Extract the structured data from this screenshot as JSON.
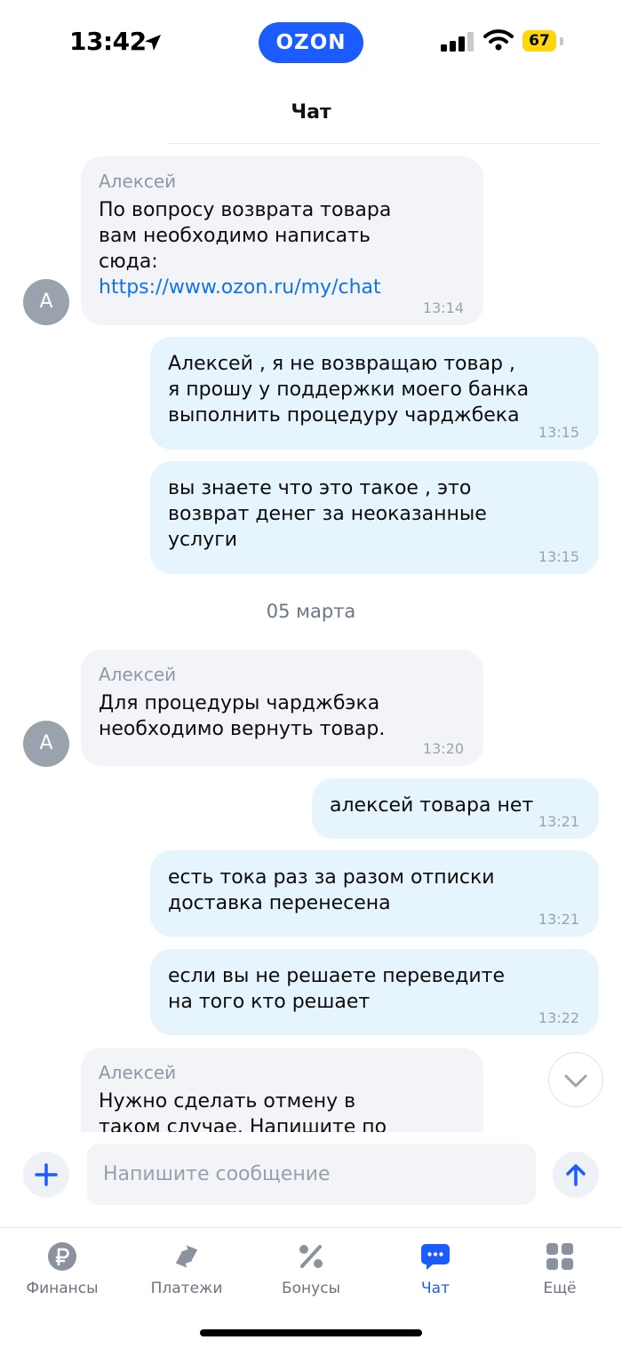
{
  "status_bar": {
    "time": "13:42",
    "brand": "OZON",
    "battery": "67"
  },
  "header": {
    "title": "Чат"
  },
  "messages": [
    {
      "sender": "Алексей",
      "text": "По вопросу возврата товара\nвам необходимо написать\nсюда:",
      "link": "https://www.ozon.ru/my/chat",
      "time": "13:14",
      "avatar": "А"
    },
    {
      "text": "Алексей , я не возвращаю товар ,\nя прошу у поддержки моего банка\nвыполнить процедуру чарджбека",
      "time": "13:15"
    },
    {
      "text": "вы знаете что это такое , это\nвозврат денег за неоказанные\nуслуги",
      "time": "13:15"
    },
    {
      "sender": "Алексей",
      "text": "Для процедуры чарджбэка\nнеобходимо вернуть товар.",
      "time": "13:20",
      "avatar": "А"
    },
    {
      "text": "алексей товара нет",
      "time": "13:21"
    },
    {
      "text": "есть тока раз за разом отписки\nдоставка перенесена",
      "time": "13:21"
    },
    {
      "text": "если вы не решаете переведите\nна того кто решает",
      "time": "13:22"
    },
    {
      "sender": "Алексей",
      "text": "Нужно сделать отмену в\nтаком случае. Напишите по"
    }
  ],
  "date_separator": "05 марта",
  "composer": {
    "placeholder": "Напишите сообщение"
  },
  "tabs": [
    {
      "label": "Финансы",
      "icon": "ruble-icon"
    },
    {
      "label": "Платежи",
      "icon": "transfer-arrows-icon"
    },
    {
      "label": "Бонусы",
      "icon": "percent-icon"
    },
    {
      "label": "Чат",
      "icon": "chat-bubble-icon",
      "active": true
    },
    {
      "label": "Ещё",
      "icon": "grid-icon"
    }
  ],
  "colors": {
    "accent": "#1a5cff",
    "incoming_bubble": "#f2f4f8",
    "outgoing_bubble": "#e6f4fd",
    "link": "#1273e6"
  }
}
